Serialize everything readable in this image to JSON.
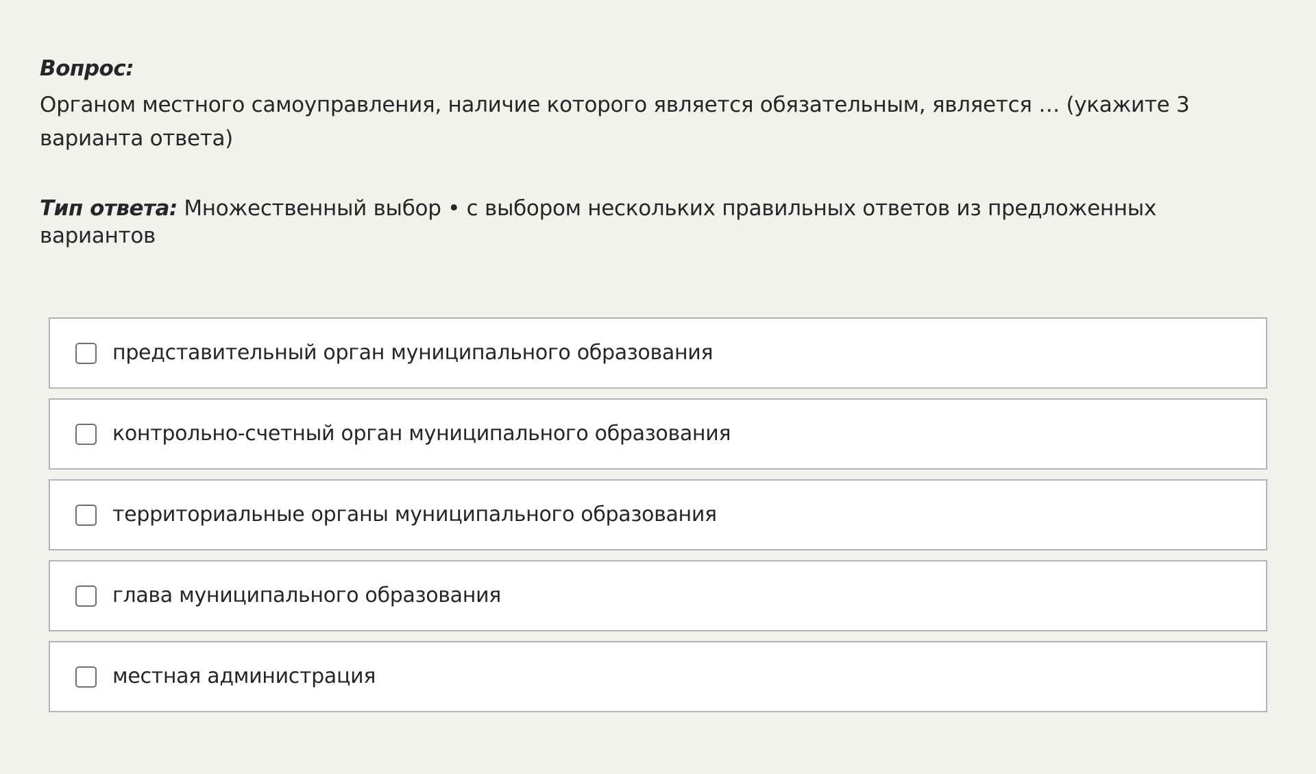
{
  "question": {
    "label": "Вопрос:",
    "text": "Органом местного самоуправления, наличие которого является обязательным, является … (укажите 3 варианта ответа)"
  },
  "answer_type": {
    "label": "Тип ответа:",
    "value": " Множественный выбор • с выбором нескольких правильных ответов из предложенных вариантов"
  },
  "options": [
    {
      "label": "представительный орган муниципального образования",
      "checked": false
    },
    {
      "label": "контрольно-счетный орган муниципального образования",
      "checked": false
    },
    {
      "label": "территориальные органы муниципального образования",
      "checked": false
    },
    {
      "label": "глава муниципального образования",
      "checked": false
    },
    {
      "label": "местная администрация",
      "checked": false
    }
  ],
  "colors": {
    "background": "#f2f1ee",
    "option_background": "#ffffff",
    "option_border": "#b3b3b3",
    "text": "#262626"
  }
}
